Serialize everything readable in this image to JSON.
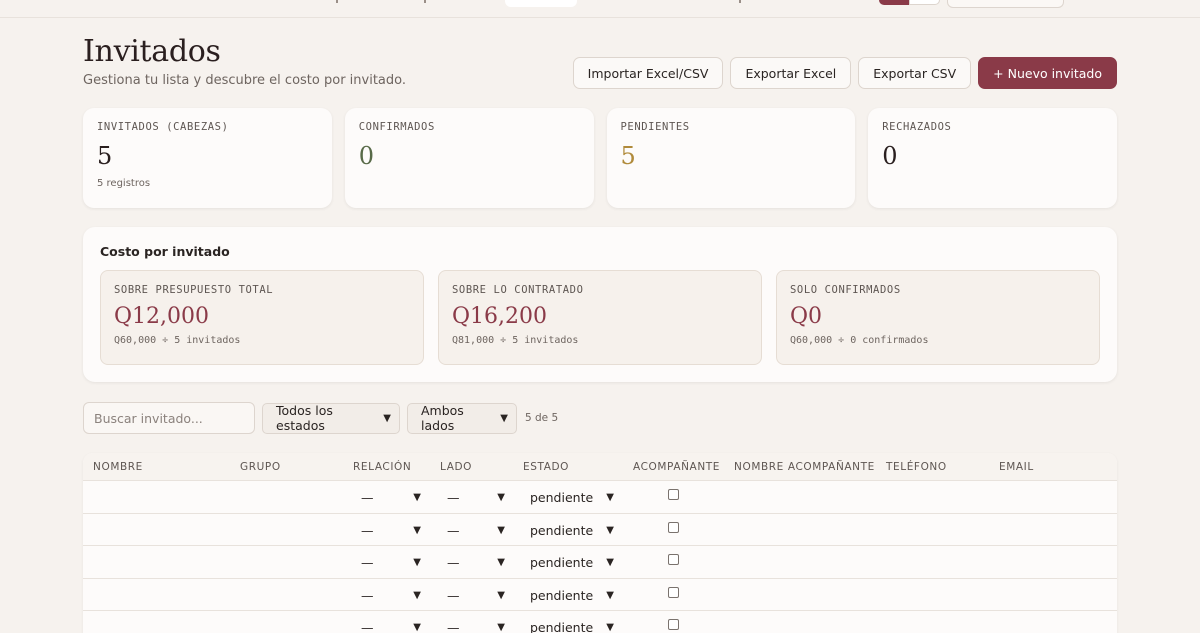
{
  "page": {
    "title": "Invitados",
    "subtitle": "Gestiona tu lista y descubre el costo por invitado."
  },
  "actions": {
    "import": "Importar Excel/CSV",
    "export_excel": "Exportar Excel",
    "export_csv": "Exportar CSV",
    "new_guest": "+ Nuevo invitado"
  },
  "stats": [
    {
      "label": "INVITADOS (CABEZAS)",
      "value": "5",
      "meta": "5 registros"
    },
    {
      "label": "CONFIRMADOS",
      "value": "0"
    },
    {
      "label": "PENDIENTES",
      "value": "5"
    },
    {
      "label": "RECHAZADOS",
      "value": "0"
    }
  ],
  "cost": {
    "title": "Costo por invitado",
    "cards": [
      {
        "label": "SOBRE PRESUPUESTO TOTAL",
        "value": "Q12,000",
        "meta": "Q60,000 ÷ 5 invitados"
      },
      {
        "label": "SOBRE LO CONTRATADO",
        "value": "Q16,200",
        "meta": "Q81,000 ÷ 5 invitados"
      },
      {
        "label": "SOLO CONFIRMADOS",
        "value": "Q0",
        "meta": "Q60,000 ÷ 0 confirmados"
      }
    ]
  },
  "filters": {
    "search_placeholder": "Buscar invitado...",
    "status": "Todos los estados",
    "side": "Ambos lados",
    "count": "5 de 5"
  },
  "table": {
    "columns": [
      "NOMBRE",
      "GRUPO",
      "RELACIÓN",
      "LADO",
      "ESTADO",
      "ACOMPAÑANTE",
      "NOMBRE ACOMPAÑANTE",
      "TELÉFONO",
      "EMAIL"
    ],
    "rows": [
      {
        "relacion": "—",
        "lado": "—",
        "estado": "pendiente"
      },
      {
        "relacion": "—",
        "lado": "—",
        "estado": "pendiente"
      },
      {
        "relacion": "—",
        "lado": "—",
        "estado": "pendiente"
      },
      {
        "relacion": "—",
        "lado": "—",
        "estado": "pendiente"
      },
      {
        "relacion": "—",
        "lado": "—",
        "estado": "pendiente"
      }
    ]
  },
  "icons": {
    "dropdown": "chevron-down-icon"
  },
  "colors": {
    "accent": "#8a3a48",
    "confirmed": "#586a48",
    "pending": "#b08a3a",
    "background": "#f6f2ee"
  }
}
